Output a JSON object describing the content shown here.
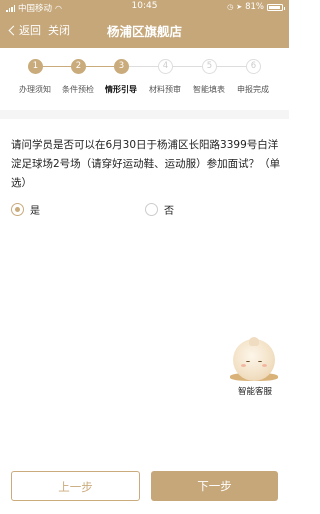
{
  "status_bar": {
    "carrier": "中国移动",
    "time": "10:45",
    "battery": "81%"
  },
  "nav": {
    "back_label": "返回",
    "close_label": "关闭",
    "title": "杨浦区旗舰店"
  },
  "steps": [
    {
      "number": "1",
      "label": "办理须知",
      "done": true
    },
    {
      "number": "2",
      "label": "条件预检",
      "done": true
    },
    {
      "number": "3",
      "label": "情形引导",
      "done": true,
      "current": true
    },
    {
      "number": "4",
      "label": "材料预审",
      "done": false
    },
    {
      "number": "5",
      "label": "智能填表",
      "done": false
    },
    {
      "number": "6",
      "label": "申报完成",
      "done": false
    }
  ],
  "question": {
    "text": "请问学员是否可以在6月30日于杨浦区长阳路3399号白洋淀足球场2号场（请穿好运动鞋、运动服）参加面试？（单选）",
    "options": [
      {
        "label": "是",
        "selected": true
      },
      {
        "label": "否",
        "selected": false
      }
    ]
  },
  "assistant": {
    "label": "智能客服"
  },
  "footer": {
    "prev_label": "上一步",
    "next_label": "下一步"
  },
  "colors": {
    "brand": "#c5a77a",
    "inactive": "#dddddd",
    "divider": "#f5f5f5"
  }
}
